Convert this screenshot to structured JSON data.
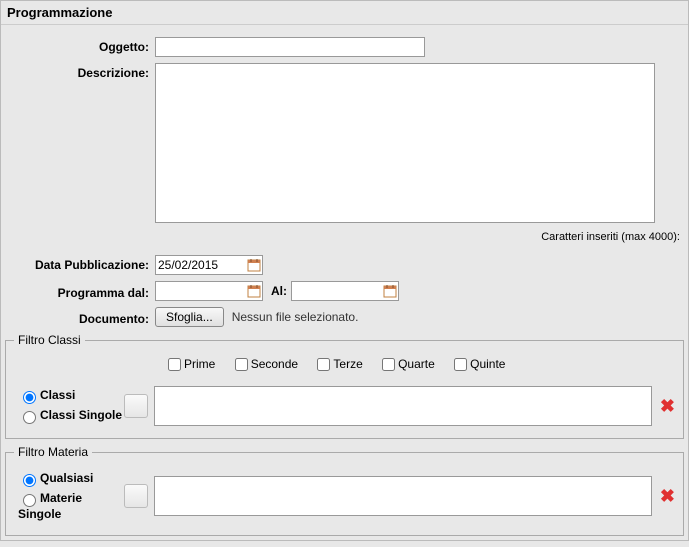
{
  "header": {
    "title": "Programmazione"
  },
  "form": {
    "oggetto_label": "Oggetto:",
    "oggetto_value": "",
    "descrizione_label": "Descrizione:",
    "descrizione_value": "",
    "counter_text": "Caratteri inseriti (max 4000):",
    "data_pub_label": "Data Pubblicazione:",
    "data_pub_value": "25/02/2015",
    "programma_dal_label": "Programma dal:",
    "programma_dal_value": "",
    "al_label": "Al:",
    "al_value": "",
    "documento_label": "Documento:",
    "sfoglia_label": "Sfoglia...",
    "file_status": "Nessun file selezionato."
  },
  "filtro_classi": {
    "legend": "Filtro Classi",
    "checks": {
      "prime": "Prime",
      "seconde": "Seconde",
      "terze": "Terze",
      "quarte": "Quarte",
      "quinte": "Quinte"
    },
    "radio_classi": "Classi",
    "radio_classi_singole": "Classi Singole",
    "list_value": ""
  },
  "filtro_materia": {
    "legend": "Filtro Materia",
    "radio_qualsiasi": "Qualsiasi",
    "radio_materie_singole": "Materie Singole",
    "list_value": ""
  }
}
